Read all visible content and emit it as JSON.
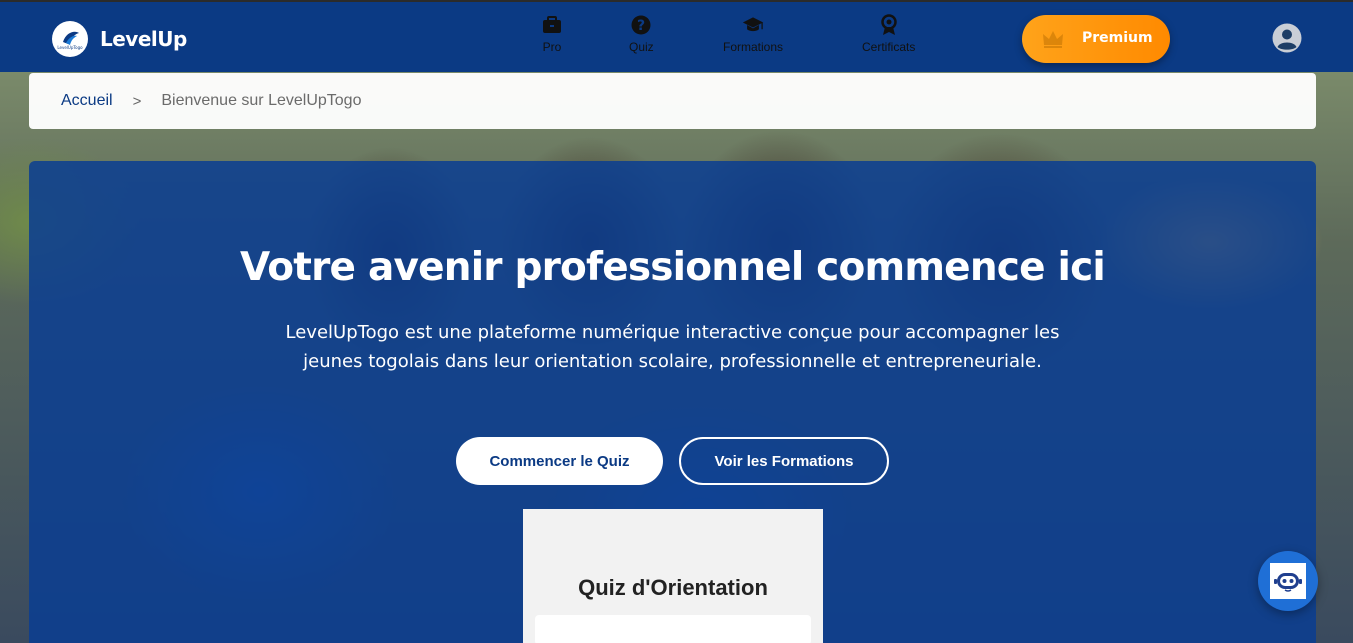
{
  "header": {
    "brand": "LevelUp",
    "logo_text": "LevelUpTogo",
    "nav": [
      {
        "label": "Pro",
        "icon": "briefcase-icon"
      },
      {
        "label": "Quiz",
        "icon": "question-circle-icon"
      },
      {
        "label": "Formations",
        "icon": "graduation-cap-icon"
      },
      {
        "label": "Certificats",
        "icon": "award-icon"
      }
    ],
    "premium_label": "Premium",
    "premium_icon": "crown-icon",
    "account_icon": "user-circle-icon"
  },
  "breadcrumb": {
    "home": "Accueil",
    "separator": ">",
    "current": "Bienvenue sur LevelUpTogo"
  },
  "hero": {
    "title": "Votre avenir professionnel commence ici",
    "description": "LevelUpTogo est une plateforme numérique interactive conçue pour accompagner les jeunes togolais dans leur orientation scolaire, professionnelle et entrepreneuriale.",
    "primary_button": "Commencer le Quiz",
    "secondary_button": "Voir les Formations"
  },
  "quiz_card": {
    "title": "Quiz d'Orientation"
  },
  "chatbot": {
    "icon": "robot-icon"
  },
  "colors": {
    "primary": "#0b3a84",
    "accent": "#ff8a00",
    "hero_overlay": "#0a3e91",
    "chatbot": "#1f6fd6"
  }
}
